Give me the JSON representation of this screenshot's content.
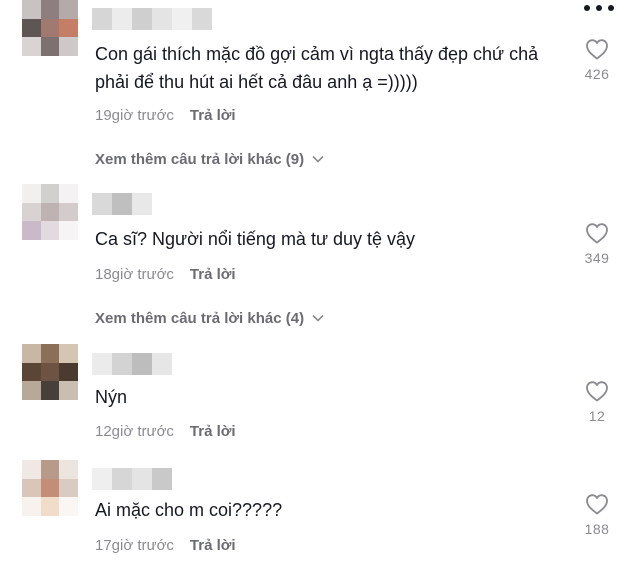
{
  "comments": [
    {
      "text": "Con gái thích mặc đồ gợi cảm vì ngta thấy đẹp chứ chả phải để thu hút ai hết cả đâu anh ạ =)))))",
      "time": "19giờ trước",
      "reply_label": "Trả lời",
      "likes": "426",
      "view_more": "Xem thêm câu trả lời khác (9)"
    },
    {
      "text": "Ca sĩ? Người nổi tiếng mà tư duy tệ vậy",
      "time": "18giờ trước",
      "reply_label": "Trả lời",
      "likes": "349",
      "view_more": "Xem thêm câu trả lời khác (4)"
    },
    {
      "text": "Nýn",
      "time": "12giờ trước",
      "reply_label": "Trả lời",
      "likes": "12"
    },
    {
      "text": "Ai mặc cho m coi?????",
      "time": "17giờ trước",
      "reply_label": "Trả lời",
      "likes": "188"
    }
  ],
  "icons": {
    "more": "more-horizontal-icon",
    "like": "heart-outline-icon",
    "expand": "chevron-down-icon"
  },
  "colors": {
    "text": "#161823",
    "muted": "#8a8b91",
    "reply": "#6b6c72"
  }
}
